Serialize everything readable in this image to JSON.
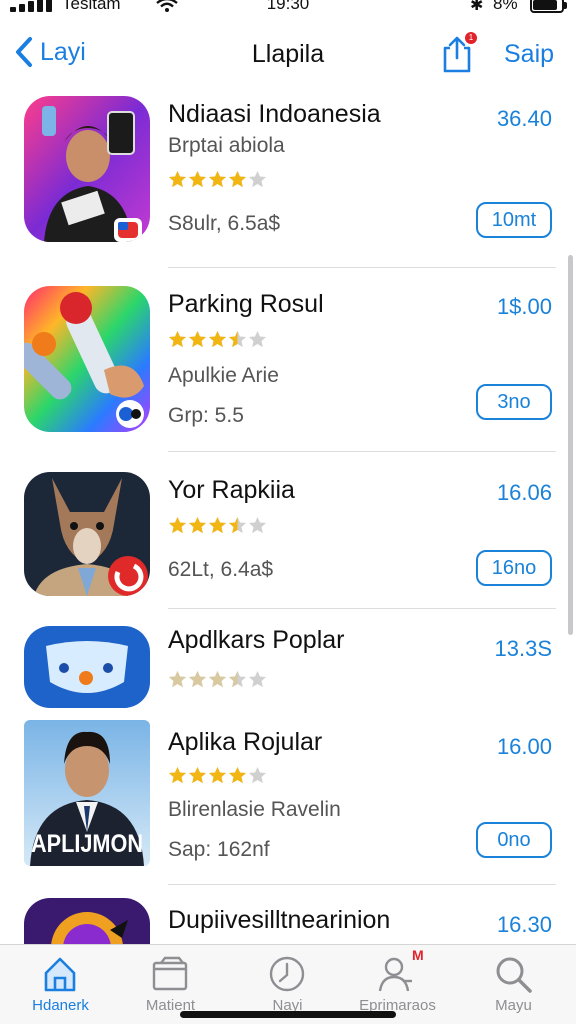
{
  "status": {
    "carrier": "Tesitam",
    "time": "19:30",
    "battery": "8%"
  },
  "nav": {
    "back_label": "Layi",
    "title": "Llapila",
    "action_label": "Saip",
    "share_badge": "1"
  },
  "apps": [
    {
      "name": "Ndiaasi Indoanesia",
      "price": "36.40",
      "subtitle": "Brptai abiola",
      "stars": 4,
      "meta": "S8ulr, 6.5a$",
      "button": "10mt"
    },
    {
      "name": "Parking Rosul",
      "price": "1$.00",
      "subtitle": "Apulkie Arie",
      "stars": 3.5,
      "meta": "Grp: 5.5",
      "button": "3no"
    },
    {
      "name": "Yor Rapkiia",
      "price": "16.06",
      "subtitle": "",
      "stars": 3.5,
      "meta": "62Lt, 6.4a$",
      "button": "16no"
    },
    {
      "name": "Apdlkars Poplar",
      "price": "13.3S",
      "subtitle": "",
      "stars": 3.5,
      "meta": "",
      "button": ""
    },
    {
      "name": "Aplika Rojular",
      "price": "16.00",
      "subtitle": "Blirenlasie Ravelin",
      "stars": 4,
      "meta": "Sap: 162nf",
      "button": "0no",
      "icon_text": "APLIJMON"
    },
    {
      "name": "Dupiivesilltnearinion",
      "price": "16.30"
    }
  ],
  "tabs": [
    {
      "label": "Hdanerk",
      "icon": "home-icon",
      "active": true
    },
    {
      "label": "Matient",
      "icon": "folder-icon"
    },
    {
      "label": "Nayi",
      "icon": "clock-icon"
    },
    {
      "label": "Eprimaraos",
      "icon": "people-icon",
      "badge": "M"
    },
    {
      "label": "Mayu",
      "icon": "search-icon"
    }
  ],
  "colors": {
    "accent": "#1a7fe0",
    "star": "#f2b614",
    "star_empty": "#d0d0d0",
    "badge": "#e0242b"
  }
}
